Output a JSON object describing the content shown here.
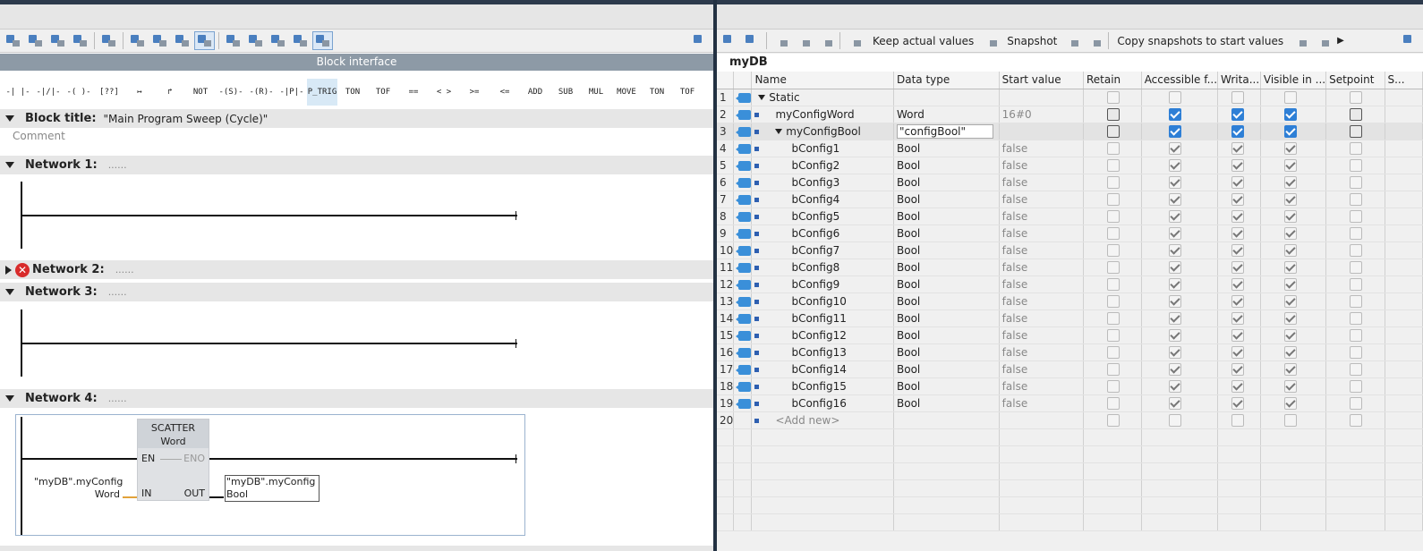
{
  "editor": {
    "toolbar_icons": [
      "insert-network-icon",
      "delete-network-icon",
      "insert-row-icon",
      "add-row-icon",
      "block-icon",
      "list-icon",
      "interface-icon",
      "blue-box-icon",
      "comment-icon",
      "network-down-icon",
      "network-sort-icon",
      "download-icon",
      "list2-icon",
      "favorite-icon"
    ],
    "block_interface_label": "Block interface",
    "ladder_items": [
      "-| |-",
      "-|/|-",
      "-( )-",
      "[??]",
      "↦",
      "↱",
      "NOT",
      "-(S)-",
      "-(R)-",
      "-|P|-",
      "P_TRIG",
      "TON",
      "TOF",
      "==",
      "< >",
      ">=",
      "<=",
      "ADD",
      "SUB",
      "MUL",
      "MOVE",
      "TON",
      "TOF"
    ],
    "block_title_label": "Block title:",
    "block_title_value": "\"Main Program Sweep (Cycle)\"",
    "comment_placeholder": "Comment",
    "networks": [
      {
        "label": "Network 1:",
        "dots": "......"
      },
      {
        "label": "Network 2:",
        "dots": "......"
      },
      {
        "label": "Network 3:",
        "dots": "......"
      },
      {
        "label": "Network 4:",
        "dots": "......"
      }
    ],
    "scatter": {
      "name": "SCATTER",
      "type": "Word",
      "en": "EN",
      "eno": "ENO",
      "in": "IN",
      "out": "OUT",
      "in_operand_1": "\"myDB\".myConfig",
      "in_operand_2": "Word",
      "out_operand_1": "\"myDB\".myConfig",
      "out_operand_2": "Bool"
    }
  },
  "db": {
    "toolbar": {
      "keep_actual_values": "Keep actual values",
      "snapshot": "Snapshot",
      "copy_snapshots": "Copy snapshots to start values"
    },
    "title": "myDB",
    "columns": [
      "",
      "",
      "Name",
      "Data type",
      "Start value",
      "Retain",
      "Accessible f...",
      "Writa...",
      "Visible in ...",
      "Setpoint",
      "S..."
    ],
    "rows": [
      {
        "n": "1",
        "name": "Static",
        "type": "",
        "start": "",
        "level": 0,
        "expand": true,
        "retain": "dim",
        "acc": "dim",
        "wr": "dim",
        "vis": "dim",
        "sp": "dim"
      },
      {
        "n": "2",
        "name": "myConfigWord",
        "type": "Word",
        "start": "16#0",
        "level": 1,
        "expand": false,
        "retain": "off",
        "acc": "blue",
        "wr": "blue",
        "vis": "blue",
        "sp": "off"
      },
      {
        "n": "3",
        "name": "myConfigBool",
        "type": "\"configBool\"",
        "start": "",
        "level": 1,
        "expand": true,
        "retain": "off",
        "acc": "blue",
        "wr": "blue",
        "vis": "blue",
        "sp": "off"
      },
      {
        "n": "4",
        "name": "bConfig1",
        "type": "Bool",
        "start": "false",
        "level": 2,
        "expand": false,
        "retain": "dim",
        "acc": "on",
        "wr": "on",
        "vis": "on",
        "sp": "dim"
      },
      {
        "n": "5",
        "name": "bConfig2",
        "type": "Bool",
        "start": "false",
        "level": 2,
        "expand": false,
        "retain": "dim",
        "acc": "on",
        "wr": "on",
        "vis": "on",
        "sp": "dim"
      },
      {
        "n": "6",
        "name": "bConfig3",
        "type": "Bool",
        "start": "false",
        "level": 2,
        "expand": false,
        "retain": "dim",
        "acc": "on",
        "wr": "on",
        "vis": "on",
        "sp": "dim"
      },
      {
        "n": "7",
        "name": "bConfig4",
        "type": "Bool",
        "start": "false",
        "level": 2,
        "expand": false,
        "retain": "dim",
        "acc": "on",
        "wr": "on",
        "vis": "on",
        "sp": "dim"
      },
      {
        "n": "8",
        "name": "bConfig5",
        "type": "Bool",
        "start": "false",
        "level": 2,
        "expand": false,
        "retain": "dim",
        "acc": "on",
        "wr": "on",
        "vis": "on",
        "sp": "dim"
      },
      {
        "n": "9",
        "name": "bConfig6",
        "type": "Bool",
        "start": "false",
        "level": 2,
        "expand": false,
        "retain": "dim",
        "acc": "on",
        "wr": "on",
        "vis": "on",
        "sp": "dim"
      },
      {
        "n": "10",
        "name": "bConfig7",
        "type": "Bool",
        "start": "false",
        "level": 2,
        "expand": false,
        "retain": "dim",
        "acc": "on",
        "wr": "on",
        "vis": "on",
        "sp": "dim"
      },
      {
        "n": "11",
        "name": "bConfig8",
        "type": "Bool",
        "start": "false",
        "level": 2,
        "expand": false,
        "retain": "dim",
        "acc": "on",
        "wr": "on",
        "vis": "on",
        "sp": "dim"
      },
      {
        "n": "12",
        "name": "bConfig9",
        "type": "Bool",
        "start": "false",
        "level": 2,
        "expand": false,
        "retain": "dim",
        "acc": "on",
        "wr": "on",
        "vis": "on",
        "sp": "dim"
      },
      {
        "n": "13",
        "name": "bConfig10",
        "type": "Bool",
        "start": "false",
        "level": 2,
        "expand": false,
        "retain": "dim",
        "acc": "on",
        "wr": "on",
        "vis": "on",
        "sp": "dim"
      },
      {
        "n": "14",
        "name": "bConfig11",
        "type": "Bool",
        "start": "false",
        "level": 2,
        "expand": false,
        "retain": "dim",
        "acc": "on",
        "wr": "on",
        "vis": "on",
        "sp": "dim"
      },
      {
        "n": "15",
        "name": "bConfig12",
        "type": "Bool",
        "start": "false",
        "level": 2,
        "expand": false,
        "retain": "dim",
        "acc": "on",
        "wr": "on",
        "vis": "on",
        "sp": "dim"
      },
      {
        "n": "16",
        "name": "bConfig13",
        "type": "Bool",
        "start": "false",
        "level": 2,
        "expand": false,
        "retain": "dim",
        "acc": "on",
        "wr": "on",
        "vis": "on",
        "sp": "dim"
      },
      {
        "n": "17",
        "name": "bConfig14",
        "type": "Bool",
        "start": "false",
        "level": 2,
        "expand": false,
        "retain": "dim",
        "acc": "on",
        "wr": "on",
        "vis": "on",
        "sp": "dim"
      },
      {
        "n": "18",
        "name": "bConfig15",
        "type": "Bool",
        "start": "false",
        "level": 2,
        "expand": false,
        "retain": "dim",
        "acc": "on",
        "wr": "on",
        "vis": "on",
        "sp": "dim"
      },
      {
        "n": "19",
        "name": "bConfig16",
        "type": "Bool",
        "start": "false",
        "level": 2,
        "expand": false,
        "retain": "dim",
        "acc": "on",
        "wr": "on",
        "vis": "on",
        "sp": "dim"
      },
      {
        "n": "20",
        "name": "<Add new>",
        "type": "",
        "start": "",
        "level": 1,
        "expand": false,
        "retain": "dim",
        "acc": "dim",
        "wr": "dim",
        "vis": "dim",
        "sp": "dim"
      }
    ]
  }
}
